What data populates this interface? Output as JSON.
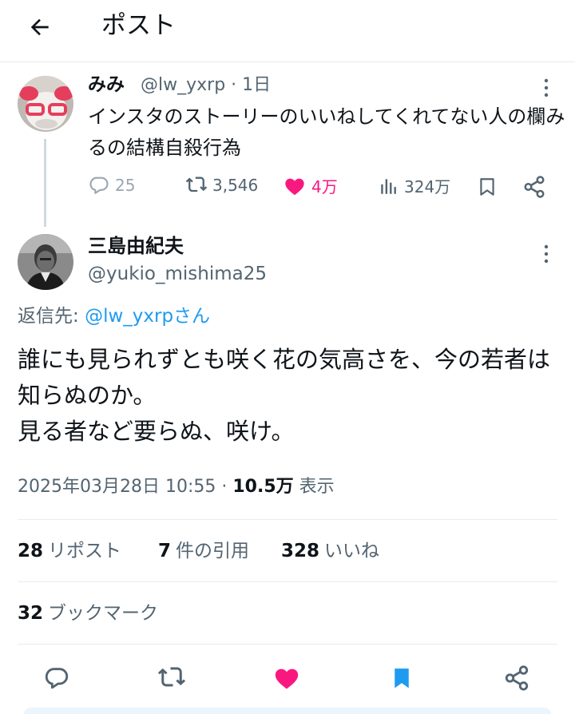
{
  "header": {
    "title": "ポスト",
    "back_icon": "arrow-left-icon"
  },
  "parent_tweet": {
    "display_name": "みみ",
    "handle_time": "@lw_yxrp · 1日",
    "text": "インスタのストーリーのいいねしてくれてない人の欄みるの結構自殺行為",
    "actions": {
      "replies": "25",
      "retweets": "3,546",
      "likes": "4万",
      "views": "324万"
    }
  },
  "main_tweet": {
    "display_name": "三島由紀夫",
    "handle": "@yukio_mishima25",
    "replying_prefix": "返信先: ",
    "replying_handle": "@lw_yxrpさん",
    "text_lines": [
      "誰にも見られずとも咲く花の気高さを、今の若者は知らぬのか。",
      "見る者など要らぬ、咲け。"
    ],
    "timestamp": "2025年03月28日 10:55 · ",
    "views_count": "10.5万",
    "views_label": " 表示"
  },
  "stats": {
    "retweets_count": "28",
    "retweets_label": "リポスト",
    "quotes_count": "7",
    "quotes_label": "件の引用",
    "likes_count": "328",
    "likes_label": "いいね",
    "bookmarks_count": "32",
    "bookmarks_label": "ブックマーク"
  },
  "colors": {
    "accent": "#1d9bf0",
    "like": "#f91880",
    "muted": "#536471"
  }
}
